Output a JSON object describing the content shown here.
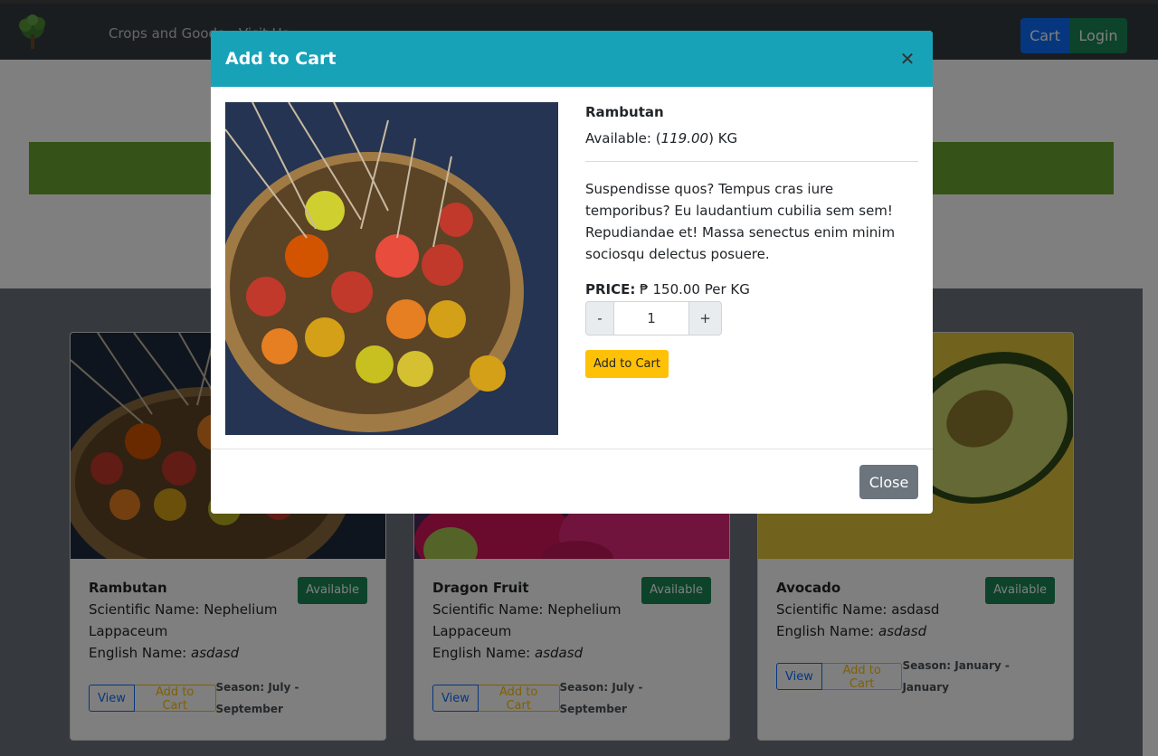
{
  "nav": {
    "links": [
      "Crops and Goods",
      "Visit Us"
    ],
    "cart_label": "Cart",
    "login_label": "Login"
  },
  "products": [
    {
      "name": "Rambutan",
      "badge": "Available",
      "sci_label": "Scientific Name:",
      "sci_value": "Nephelium Lappaceum",
      "eng_label": "English Name:",
      "eng_value": "asdasd",
      "view_label": "View",
      "add_label": "Add to Cart",
      "season": "Season: July - September"
    },
    {
      "name": "Dragon Fruit",
      "badge": "Available",
      "sci_label": "Scientific Name:",
      "sci_value": "Nephelium Lappaceum",
      "eng_label": "English Name:",
      "eng_value": "asdasd",
      "view_label": "View",
      "add_label": "Add to Cart",
      "season": "Season: July - September"
    },
    {
      "name": "Avocado",
      "badge": "Available",
      "sci_label": "Scientific Name:",
      "sci_value": "asdasd",
      "eng_label": "English Name:",
      "eng_value": "asdasd",
      "view_label": "View",
      "add_label": "Add to Cart",
      "season": "Season: January - January"
    }
  ],
  "modal": {
    "title": "Add to Cart",
    "close_icon": "close-icon",
    "product_name": "Rambutan",
    "available_prefix": "Available: (",
    "available_qty": "119.00",
    "available_suffix": ") KG",
    "description": "Suspendisse quos? Tempus cras iure temporibus? Eu laudantium cubilia sem sem! Repudiandae et! Massa senectus enim minim sociosqu delectus posuere.",
    "price_label": "PRICE:",
    "price_value": "₱ 150.00 Per KG",
    "qty_minus": "-",
    "qty_value": "1",
    "qty_plus": "+",
    "add_button": "Add to Cart",
    "close_button": "Close"
  },
  "colors": {
    "header_teal": "#17a2b8",
    "accent_yellow": "#ffc107",
    "available_green": "#198754",
    "hero_green": "#6aa530"
  }
}
